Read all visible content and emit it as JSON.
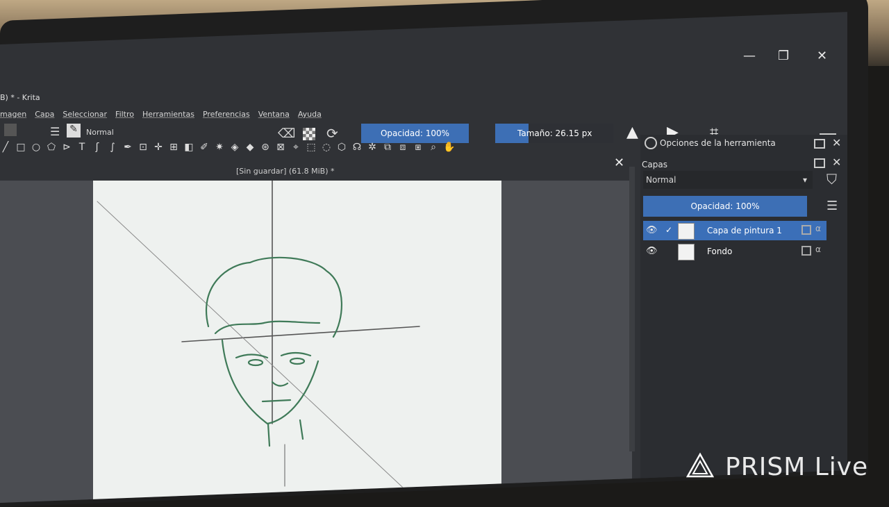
{
  "window": {
    "title": "B) * - Krita",
    "controls": {
      "minimize": "—",
      "maximize": "❐",
      "close": "✕"
    }
  },
  "menubar": [
    "magen",
    "Capa",
    "Seleccionar",
    "Filtro",
    "Herramientas",
    "Preferencias",
    "Ventana",
    "Ayuda"
  ],
  "toolbar": {
    "blend_mode": "Normal",
    "opacity_label": "Opacidad: 100%",
    "opacity_value": 1.0,
    "size_label": "Tamaño: 26.15 px"
  },
  "document": {
    "title": "[Sin guardar] (61.8 MiB) *"
  },
  "tool_options": {
    "title": "Opciones de la herramienta"
  },
  "layers_panel": {
    "title": "Capas",
    "blend_mode": "Normal",
    "opacity_label": "Opacidad:  100%",
    "layers": [
      {
        "name": "Capa de pintura 1",
        "selected": true,
        "visible": true
      },
      {
        "name": "Fondo",
        "selected": false,
        "visible": true
      }
    ]
  },
  "watermark": {
    "text": "PRISM Live"
  },
  "colors": {
    "accent": "#3d6fb5",
    "sketch": "#3f7a58",
    "paper": "#eef1ef"
  }
}
